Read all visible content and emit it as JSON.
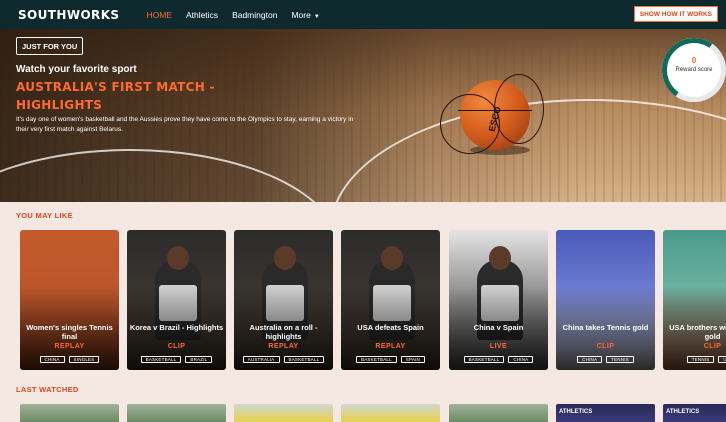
{
  "nav": {
    "logo": "SOUTHWORKS",
    "links": [
      {
        "label": "HOME",
        "active": true
      },
      {
        "label": "Athletics"
      },
      {
        "label": "Badmington"
      },
      {
        "label": "More"
      }
    ],
    "cta": "SHOW HOW IT WORKS"
  },
  "hero": {
    "tag": "JUST FOR YOU",
    "subtitle": "Watch your favorite sport",
    "title": "AUSTRALIA'S FIRST MATCH - HIGHLIGHTS",
    "description": "It's day one of women's basketball and the Aussies prove they have come to the Olympics to stay, earning a victory in their very first match against Belarus.",
    "ball_text": "ESCO"
  },
  "reward": {
    "value": "0",
    "label": "Reward score"
  },
  "sections": {
    "you_may_like": "YOU MAY LIKE",
    "last_watched": "LAST WATCHED"
  },
  "cards": [
    {
      "title": "Women's singles Tennis final",
      "kind": "REPLAY",
      "tags": [
        "CHINA",
        "SINGLES"
      ],
      "bg": "clay"
    },
    {
      "title": "Korea v Brazil - Highlights",
      "kind": "CLIP",
      "tags": [
        "BASKETBALL",
        "BRAZIL"
      ],
      "bg": "gym"
    },
    {
      "title": "Australia on a roll - highlights",
      "kind": "REPLAY",
      "tags": [
        "AUSTRALIA",
        "BASKETBALL"
      ],
      "bg": "gym"
    },
    {
      "title": "USA defeats Spain",
      "kind": "REPLAY",
      "tags": [
        "BASKETBALL",
        "SPAIN"
      ],
      "bg": "gym"
    },
    {
      "title": "China v Spain",
      "kind": "LIVE",
      "tags": [
        "BASKETBALL",
        "CHINA"
      ],
      "bg": "arena"
    },
    {
      "title": "China takes Tennis gold",
      "kind": "CLIP",
      "tags": [
        "CHINA",
        "TENNIS"
      ],
      "bg": "podium"
    },
    {
      "title": "USA brothers win tennis gold",
      "kind": "CLIP",
      "tags": [
        "TENNIS",
        "USA"
      ],
      "bg": "court"
    }
  ],
  "bottom_cards": [
    {
      "bg": "trees"
    },
    {
      "bg": "trees"
    },
    {
      "bg": "yellow"
    },
    {
      "bg": "yellow"
    },
    {
      "bg": "trees"
    },
    {
      "bg": "athletics",
      "label": "ATHLETICS"
    },
    {
      "bg": "athletics",
      "label": "ATHLETICS"
    }
  ],
  "colors": {
    "nav": "#0f2a2e",
    "accent": "#ff6a2e",
    "background": "#f5e8e2"
  }
}
